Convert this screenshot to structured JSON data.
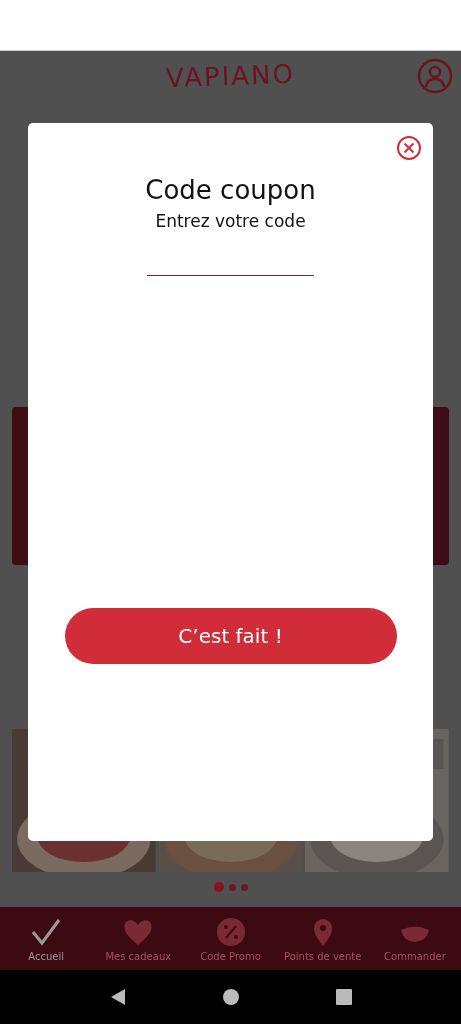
{
  "header": {
    "logo": "VAPIANO"
  },
  "gallery": {
    "dots": [
      {
        "selected": true
      },
      {
        "selected": false
      },
      {
        "selected": false
      }
    ]
  },
  "bottom_nav": [
    {
      "label": "Accueil",
      "selected": true
    },
    {
      "label": "Mes cadeaux",
      "selected": false
    },
    {
      "label": "Code Promo",
      "selected": false
    },
    {
      "label": "Points de vente",
      "selected": false
    },
    {
      "label": "Commander",
      "selected": false
    }
  ],
  "dialog": {
    "title": "Code coupon",
    "subtitle": "Entrez votre code",
    "button": "C’est fait !"
  }
}
